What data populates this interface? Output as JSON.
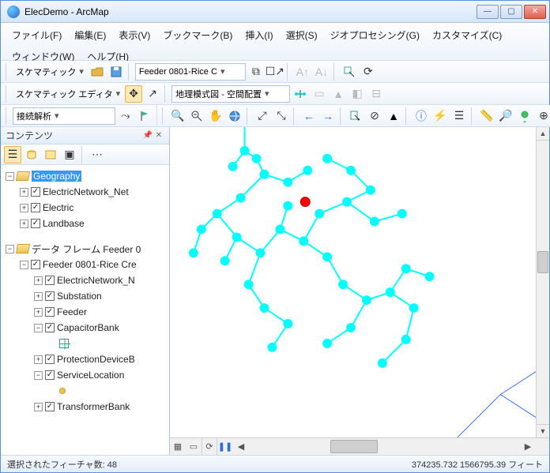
{
  "window": {
    "title": "ElecDemo - ArcMap"
  },
  "menu": {
    "file": "ファイル(F)",
    "edit": "編集(E)",
    "view": "表示(V)",
    "bookmarks": "ブックマーク(B)",
    "insert": "挿入(I)",
    "selection": "選択(S)",
    "geoprocessing": "ジオプロセシング(G)",
    "customize": "カスタマイズ(C)",
    "windows": "ウィンドウ(W)",
    "help": "ヘルプ(H)"
  },
  "toolbars": {
    "schematic": "スケマティック",
    "feeder_dd": "Feeder 0801-Rice C",
    "schematic_editor": "スケマティック エディタ",
    "layout_dd": "地理模式図 - 空間配置",
    "analysis_dd": "接続解析"
  },
  "toc": {
    "title": "コンテンツ",
    "items": [
      {
        "kind": "df",
        "exp": "−",
        "label": "Geography",
        "selected": true,
        "depth": 0
      },
      {
        "kind": "layer",
        "cb": true,
        "exp": "+",
        "label": "ElectricNetwork_Net",
        "depth": 1
      },
      {
        "kind": "layer",
        "cb": true,
        "exp": "+",
        "label": "Electric",
        "depth": 1
      },
      {
        "kind": "layer",
        "cb": true,
        "exp": "+",
        "label": "Landbase",
        "depth": 1
      },
      {
        "kind": "spacer"
      },
      {
        "kind": "df",
        "exp": "−",
        "label": "データ フレーム Feeder 0",
        "depth": 0
      },
      {
        "kind": "layer",
        "cb": true,
        "exp": "−",
        "label": "Feeder 0801-Rice Cre",
        "depth": 1
      },
      {
        "kind": "layer",
        "cb": true,
        "exp": "+",
        "label": "ElectricNetwork_N",
        "depth": 2
      },
      {
        "kind": "layer",
        "cb": true,
        "exp": "+",
        "label": "Substation",
        "depth": 2
      },
      {
        "kind": "layer",
        "cb": true,
        "exp": "+",
        "label": "Feeder",
        "depth": 2
      },
      {
        "kind": "layer",
        "cb": true,
        "exp": "−",
        "label": "CapacitorBank",
        "depth": 2
      },
      {
        "kind": "symbol",
        "sym": "box",
        "depth": 3
      },
      {
        "kind": "layer",
        "cb": true,
        "exp": "+",
        "label": "ProtectionDeviceB",
        "depth": 2
      },
      {
        "kind": "layer",
        "cb": true,
        "exp": "−",
        "label": "ServiceLocation",
        "depth": 2
      },
      {
        "kind": "symbol",
        "sym": "circle",
        "depth": 3
      },
      {
        "kind": "layer",
        "cb": true,
        "exp": "+",
        "label": "TransformerBank",
        "depth": 2
      }
    ]
  },
  "status": {
    "selection_label": "選択されたフィーチャ数:",
    "selection_count": "48",
    "coords": "374235.732  1566795.39",
    "units": "フィート"
  },
  "colors": {
    "highlight": "#00ffff",
    "flag": "#ff0000",
    "edge": "#3a6fff"
  }
}
